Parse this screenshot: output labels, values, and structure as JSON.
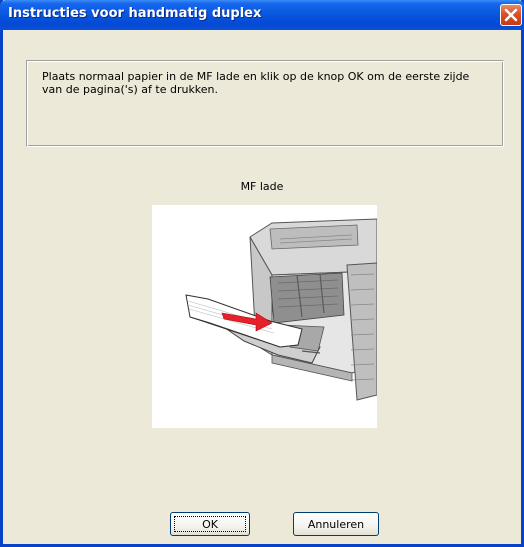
{
  "dialog": {
    "title": "Instructies voor handmatig duplex",
    "close_icon": "close-icon",
    "message": "Plaats normaal papier in de MF lade en klik op de knop OK om de eerste zijde van de pagina('s) af te drukken.",
    "tray_label": "MF lade",
    "illustration": "printer-mf-tray-illustration",
    "ok_label": "OK",
    "cancel_label": "Annuleren"
  },
  "colors": {
    "titlebar": "#0a57e0",
    "window_bg": "#ece9d8",
    "close_button": "#d7512a",
    "arrow": "#e8202a"
  }
}
